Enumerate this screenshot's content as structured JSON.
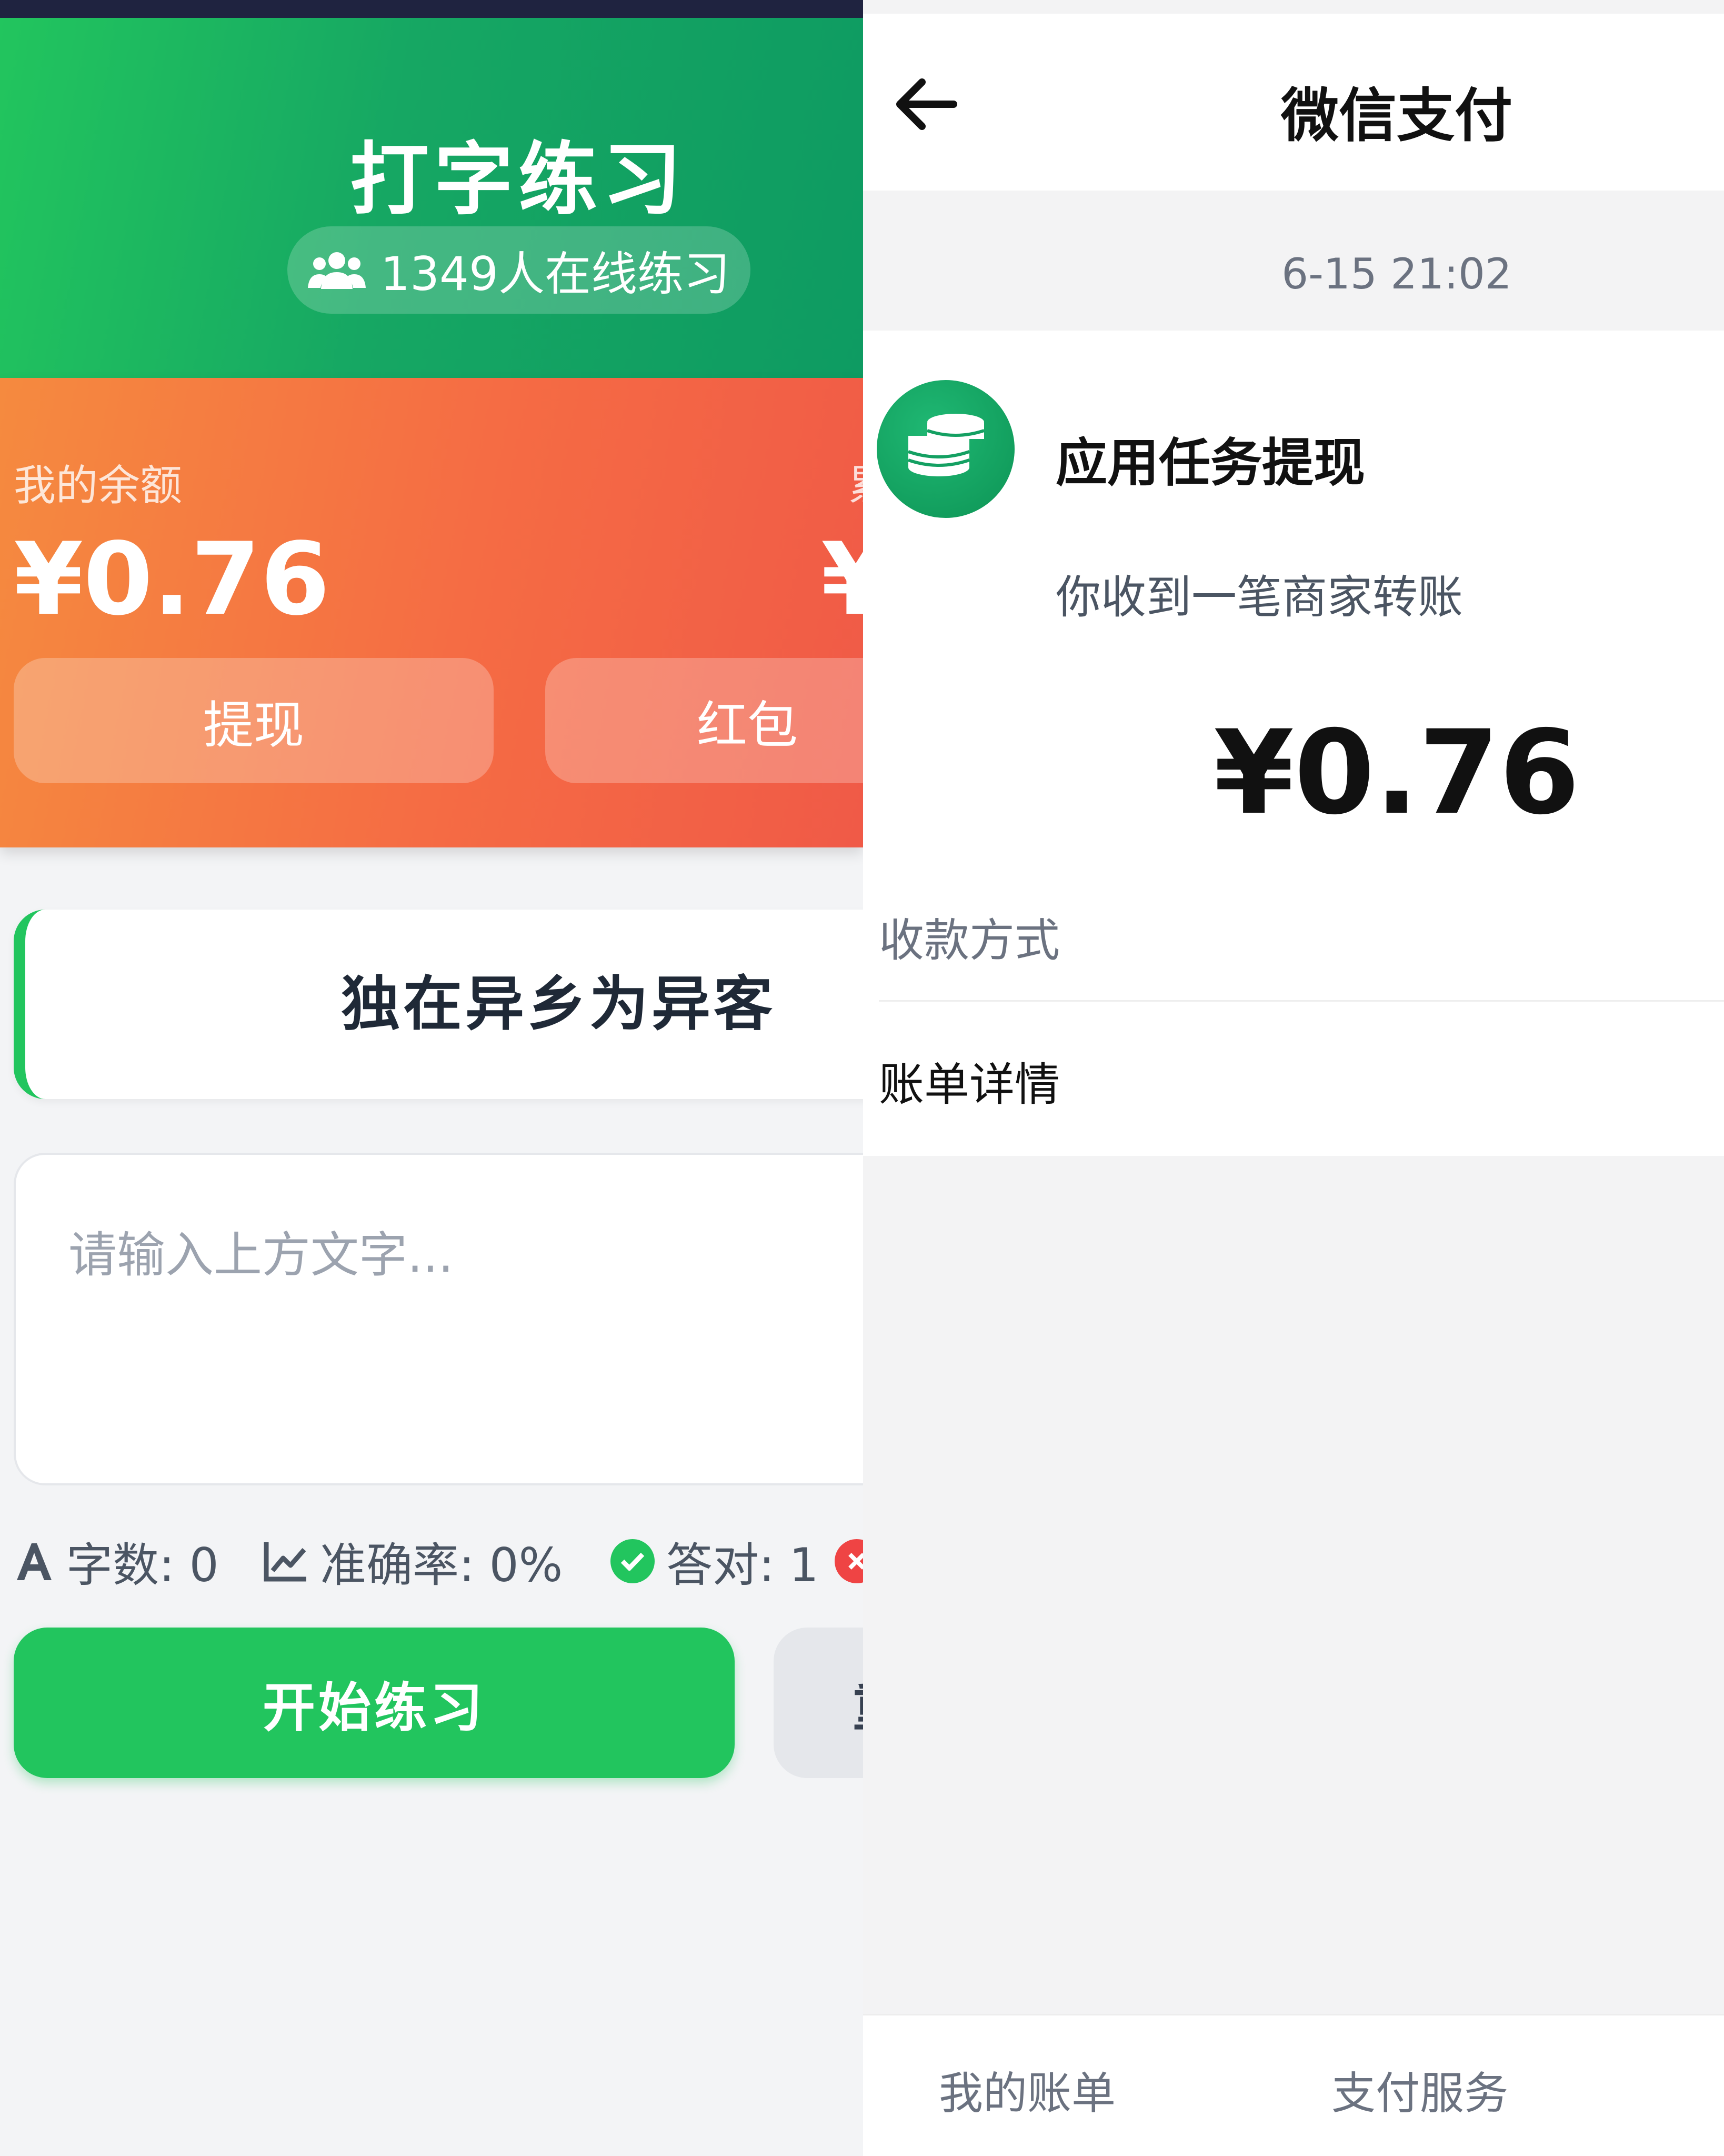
{
  "typing_app": {
    "title": "打字练习",
    "online_count": "1349人在线练习",
    "balance_label": "我的余额",
    "balance_value": "¥0.76",
    "cut_label": "累",
    "cut_value": "¥",
    "withdraw_label": "提现",
    "redpacket_label": "红包",
    "prompt_text": "独在异乡为异客",
    "input_placeholder": "请输入上方文字...",
    "stats": {
      "chars": "字数: 0",
      "accuracy": "准确率: 0%",
      "correct": "答对: 1"
    },
    "start_label": "开始练习",
    "reset_label": "重"
  },
  "wechat_pay": {
    "title": "微信支付",
    "time": "6-15 21:02",
    "merchant": "应用任务提现",
    "subtitle": "你收到一笔商家转账",
    "amount": "¥0.76",
    "row_method": "收款方式",
    "row_details": "账单详情",
    "tab_bills": "我的账单",
    "tab_services": "支付服务"
  },
  "colors": {
    "green": "#22c55e",
    "orange": "#f58a3f",
    "red": "#f05a47"
  }
}
